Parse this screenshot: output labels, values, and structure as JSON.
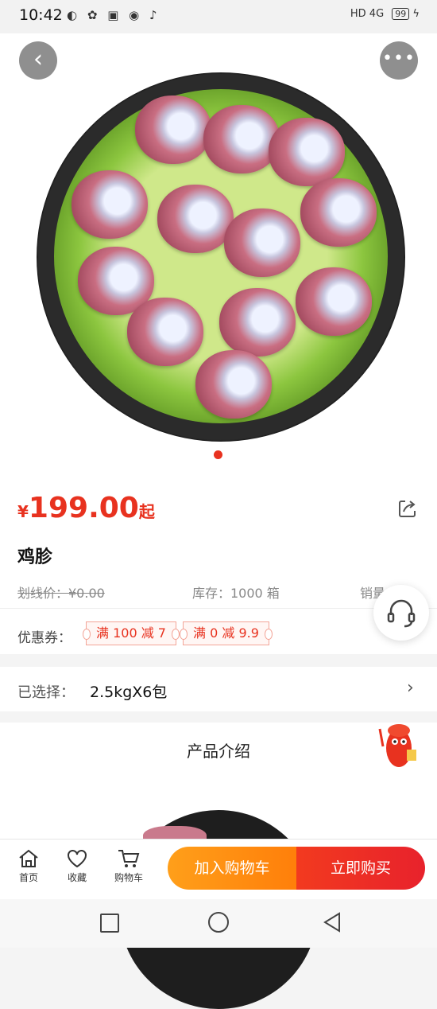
{
  "status_bar": {
    "time": "10:42",
    "right": "HD 4G",
    "battery": "99"
  },
  "product": {
    "price_currency": "¥",
    "price": "199.00",
    "price_suffix": "起",
    "title": "鸡胗",
    "original_price": "划线价：¥0.00",
    "stock": "库存：1000 箱",
    "sales": "销量"
  },
  "coupons": {
    "label": "优惠券：",
    "items": [
      "满 100 减 7",
      "满 0 减 9.9"
    ]
  },
  "selection": {
    "label": "已选择：",
    "value": "2.5kgX6包"
  },
  "intro": {
    "title": "产品介绍"
  },
  "bottom_bar": {
    "tabs": [
      {
        "label": "首页",
        "icon": "home-icon"
      },
      {
        "label": "收藏",
        "icon": "heart-icon"
      },
      {
        "label": "购物车",
        "icon": "cart-icon"
      }
    ],
    "add_to_cart": "加入购物车",
    "buy_now": "立即购买"
  },
  "colors": {
    "accent_red": "#e8321f",
    "accent_orange": "#ff8c10"
  }
}
